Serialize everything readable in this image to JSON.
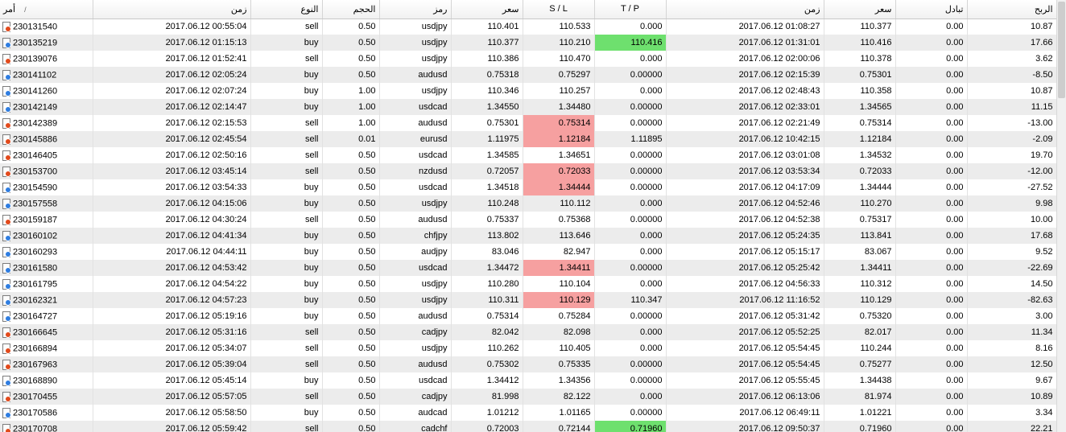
{
  "colors": {
    "buy_marker": "#2f7de0",
    "sell_marker": "#e24a1c",
    "sl_hit": "#f6a0a0",
    "tp_hit": "#6ee06e"
  },
  "header": {
    "order": "أمر",
    "sort_icon": "/",
    "open_time": "زمن",
    "type": "النوع",
    "volume": "الحجم",
    "symbol": "رمز",
    "open_price": "سعر",
    "sl": "S / L",
    "tp": "T / P",
    "close_time": "زمن",
    "close_price": "سعر",
    "swap": "تبادل",
    "profit": "الربح"
  },
  "rows": [
    {
      "ticket": "230131540",
      "open_time": "2017.06.12 00:55:04",
      "type": "sell",
      "volume": "0.50",
      "symbol": "usdjpy",
      "open_price": "110.401",
      "sl": "110.533",
      "tp": "0.000",
      "close_time": "2017.06.12 01:08:27",
      "close_price": "110.377",
      "swap": "0.00",
      "profit": "10.87",
      "hit": ""
    },
    {
      "ticket": "230135219",
      "open_time": "2017.06.12 01:15:13",
      "type": "buy",
      "volume": "0.50",
      "symbol": "usdjpy",
      "open_price": "110.377",
      "sl": "110.210",
      "tp": "110.416",
      "close_time": "2017.06.12 01:31:01",
      "close_price": "110.416",
      "swap": "0.00",
      "profit": "17.66",
      "hit": "tp"
    },
    {
      "ticket": "230139076",
      "open_time": "2017.06.12 01:52:41",
      "type": "sell",
      "volume": "0.50",
      "symbol": "usdjpy",
      "open_price": "110.386",
      "sl": "110.470",
      "tp": "0.000",
      "close_time": "2017.06.12 02:00:06",
      "close_price": "110.378",
      "swap": "0.00",
      "profit": "3.62",
      "hit": ""
    },
    {
      "ticket": "230141102",
      "open_time": "2017.06.12 02:05:24",
      "type": "buy",
      "volume": "0.50",
      "symbol": "audusd",
      "open_price": "0.75318",
      "sl": "0.75297",
      "tp": "0.00000",
      "close_time": "2017.06.12 02:15:39",
      "close_price": "0.75301",
      "swap": "0.00",
      "profit": "-8.50",
      "hit": ""
    },
    {
      "ticket": "230141260",
      "open_time": "2017.06.12 02:07:24",
      "type": "buy",
      "volume": "1.00",
      "symbol": "usdjpy",
      "open_price": "110.346",
      "sl": "110.257",
      "tp": "0.000",
      "close_time": "2017.06.12 02:48:43",
      "close_price": "110.358",
      "swap": "0.00",
      "profit": "10.87",
      "hit": ""
    },
    {
      "ticket": "230142149",
      "open_time": "2017.06.12 02:14:47",
      "type": "buy",
      "volume": "1.00",
      "symbol": "usdcad",
      "open_price": "1.34550",
      "sl": "1.34480",
      "tp": "0.00000",
      "close_time": "2017.06.12 02:33:01",
      "close_price": "1.34565",
      "swap": "0.00",
      "profit": "11.15",
      "hit": ""
    },
    {
      "ticket": "230142389",
      "open_time": "2017.06.12 02:15:53",
      "type": "sell",
      "volume": "1.00",
      "symbol": "audusd",
      "open_price": "0.75301",
      "sl": "0.75314",
      "tp": "0.00000",
      "close_time": "2017.06.12 02:21:49",
      "close_price": "0.75314",
      "swap": "0.00",
      "profit": "-13.00",
      "hit": "sl"
    },
    {
      "ticket": "230145886",
      "open_time": "2017.06.12 02:45:54",
      "type": "sell",
      "volume": "0.01",
      "symbol": "eurusd",
      "open_price": "1.11975",
      "sl": "1.12184",
      "tp": "1.11895",
      "close_time": "2017.06.12 10:42:15",
      "close_price": "1.12184",
      "swap": "0.00",
      "profit": "-2.09",
      "hit": "sl"
    },
    {
      "ticket": "230146405",
      "open_time": "2017.06.12 02:50:16",
      "type": "sell",
      "volume": "0.50",
      "symbol": "usdcad",
      "open_price": "1.34585",
      "sl": "1.34651",
      "tp": "0.00000",
      "close_time": "2017.06.12 03:01:08",
      "close_price": "1.34532",
      "swap": "0.00",
      "profit": "19.70",
      "hit": ""
    },
    {
      "ticket": "230153700",
      "open_time": "2017.06.12 03:45:14",
      "type": "sell",
      "volume": "0.50",
      "symbol": "nzdusd",
      "open_price": "0.72057",
      "sl": "0.72033",
      "tp": "0.00000",
      "close_time": "2017.06.12 03:53:34",
      "close_price": "0.72033",
      "swap": "0.00",
      "profit": "-12.00",
      "hit": "sl"
    },
    {
      "ticket": "230154590",
      "open_time": "2017.06.12 03:54:33",
      "type": "buy",
      "volume": "0.50",
      "symbol": "usdcad",
      "open_price": "1.34518",
      "sl": "1.34444",
      "tp": "0.00000",
      "close_time": "2017.06.12 04:17:09",
      "close_price": "1.34444",
      "swap": "0.00",
      "profit": "-27.52",
      "hit": "sl"
    },
    {
      "ticket": "230157558",
      "open_time": "2017.06.12 04:15:06",
      "type": "buy",
      "volume": "0.50",
      "symbol": "usdjpy",
      "open_price": "110.248",
      "sl": "110.112",
      "tp": "0.000",
      "close_time": "2017.06.12 04:52:46",
      "close_price": "110.270",
      "swap": "0.00",
      "profit": "9.98",
      "hit": ""
    },
    {
      "ticket": "230159187",
      "open_time": "2017.06.12 04:30:24",
      "type": "sell",
      "volume": "0.50",
      "symbol": "audusd",
      "open_price": "0.75337",
      "sl": "0.75368",
      "tp": "0.00000",
      "close_time": "2017.06.12 04:52:38",
      "close_price": "0.75317",
      "swap": "0.00",
      "profit": "10.00",
      "hit": ""
    },
    {
      "ticket": "230160102",
      "open_time": "2017.06.12 04:41:34",
      "type": "buy",
      "volume": "0.50",
      "symbol": "chfjpy",
      "open_price": "113.802",
      "sl": "113.646",
      "tp": "0.000",
      "close_time": "2017.06.12 05:24:35",
      "close_price": "113.841",
      "swap": "0.00",
      "profit": "17.68",
      "hit": ""
    },
    {
      "ticket": "230160293",
      "open_time": "2017.06.12 04:44:11",
      "type": "buy",
      "volume": "0.50",
      "symbol": "audjpy",
      "open_price": "83.046",
      "sl": "82.947",
      "tp": "0.000",
      "close_time": "2017.06.12 05:15:17",
      "close_price": "83.067",
      "swap": "0.00",
      "profit": "9.52",
      "hit": ""
    },
    {
      "ticket": "230161580",
      "open_time": "2017.06.12 04:53:42",
      "type": "buy",
      "volume": "0.50",
      "symbol": "usdcad",
      "open_price": "1.34472",
      "sl": "1.34411",
      "tp": "0.00000",
      "close_time": "2017.06.12 05:25:42",
      "close_price": "1.34411",
      "swap": "0.00",
      "profit": "-22.69",
      "hit": "sl"
    },
    {
      "ticket": "230161795",
      "open_time": "2017.06.12 04:54:22",
      "type": "buy",
      "volume": "0.50",
      "symbol": "usdjpy",
      "open_price": "110.280",
      "sl": "110.104",
      "tp": "0.000",
      "close_time": "2017.06.12 04:56:33",
      "close_price": "110.312",
      "swap": "0.00",
      "profit": "14.50",
      "hit": ""
    },
    {
      "ticket": "230162321",
      "open_time": "2017.06.12 04:57:23",
      "type": "buy",
      "volume": "0.50",
      "symbol": "usdjpy",
      "open_price": "110.311",
      "sl": "110.129",
      "tp": "110.347",
      "close_time": "2017.06.12 11:16:52",
      "close_price": "110.129",
      "swap": "0.00",
      "profit": "-82.63",
      "hit": "sl"
    },
    {
      "ticket": "230164727",
      "open_time": "2017.06.12 05:19:16",
      "type": "buy",
      "volume": "0.50",
      "symbol": "audusd",
      "open_price": "0.75314",
      "sl": "0.75284",
      "tp": "0.00000",
      "close_time": "2017.06.12 05:31:42",
      "close_price": "0.75320",
      "swap": "0.00",
      "profit": "3.00",
      "hit": ""
    },
    {
      "ticket": "230166645",
      "open_time": "2017.06.12 05:31:16",
      "type": "sell",
      "volume": "0.50",
      "symbol": "cadjpy",
      "open_price": "82.042",
      "sl": "82.098",
      "tp": "0.000",
      "close_time": "2017.06.12 05:52:25",
      "close_price": "82.017",
      "swap": "0.00",
      "profit": "11.34",
      "hit": ""
    },
    {
      "ticket": "230166894",
      "open_time": "2017.06.12 05:34:07",
      "type": "sell",
      "volume": "0.50",
      "symbol": "usdjpy",
      "open_price": "110.262",
      "sl": "110.405",
      "tp": "0.000",
      "close_time": "2017.06.12 05:54:45",
      "close_price": "110.244",
      "swap": "0.00",
      "profit": "8.16",
      "hit": ""
    },
    {
      "ticket": "230167963",
      "open_time": "2017.06.12 05:39:04",
      "type": "sell",
      "volume": "0.50",
      "symbol": "audusd",
      "open_price": "0.75302",
      "sl": "0.75335",
      "tp": "0.00000",
      "close_time": "2017.06.12 05:54:45",
      "close_price": "0.75277",
      "swap": "0.00",
      "profit": "12.50",
      "hit": ""
    },
    {
      "ticket": "230168890",
      "open_time": "2017.06.12 05:45:14",
      "type": "buy",
      "volume": "0.50",
      "symbol": "usdcad",
      "open_price": "1.34412",
      "sl": "1.34356",
      "tp": "0.00000",
      "close_time": "2017.06.12 05:55:45",
      "close_price": "1.34438",
      "swap": "0.00",
      "profit": "9.67",
      "hit": ""
    },
    {
      "ticket": "230170455",
      "open_time": "2017.06.12 05:57:05",
      "type": "sell",
      "volume": "0.50",
      "symbol": "cadjpy",
      "open_price": "81.998",
      "sl": "82.122",
      "tp": "0.000",
      "close_time": "2017.06.12 06:13:06",
      "close_price": "81.974",
      "swap": "0.00",
      "profit": "10.89",
      "hit": ""
    },
    {
      "ticket": "230170586",
      "open_time": "2017.06.12 05:58:50",
      "type": "buy",
      "volume": "0.50",
      "symbol": "audcad",
      "open_price": "1.01212",
      "sl": "1.01165",
      "tp": "0.00000",
      "close_time": "2017.06.12 06:49:11",
      "close_price": "1.01221",
      "swap": "0.00",
      "profit": "3.34",
      "hit": ""
    },
    {
      "ticket": "230170708",
      "open_time": "2017.06.12 05:59:42",
      "type": "sell",
      "volume": "0.50",
      "symbol": "cadchf",
      "open_price": "0.72003",
      "sl": "0.72144",
      "tp": "0.71960",
      "close_time": "2017.06.12 09:50:37",
      "close_price": "0.71960",
      "swap": "0.00",
      "profit": "22.21",
      "hit": "tp"
    }
  ]
}
